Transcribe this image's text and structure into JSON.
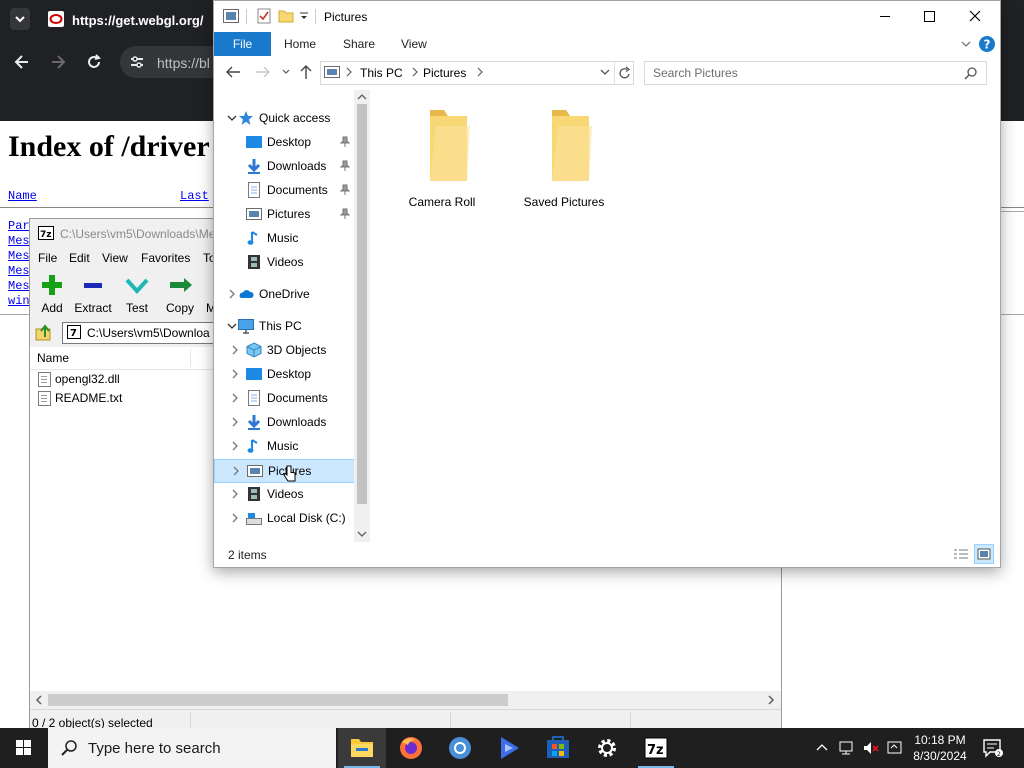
{
  "browser": {
    "tab_title": "https://get.webgl.org/",
    "url": "https://bl",
    "page_heading": "Index of /driver",
    "col_name": "Name",
    "col_last": "Last",
    "links": [
      "Par",
      "Mes",
      "Mes",
      "Mes",
      "Mes",
      "win"
    ]
  },
  "sevenzip": {
    "title": "C:\\Users\\vm5\\Downloads\\Me",
    "menu": [
      "File",
      "Edit",
      "View",
      "Favorites",
      "To"
    ],
    "toolbar": {
      "add": "Add",
      "extract": "Extract",
      "test": "Test",
      "copy": "Copy",
      "move": "M"
    },
    "address": "C:\\Users\\vm5\\Downloa",
    "column_name": "Name",
    "files": [
      "opengl32.dll",
      "README.txt"
    ],
    "status": "0 / 2 object(s) selected"
  },
  "explorer": {
    "title": "Pictures",
    "ribbon_tabs": {
      "file": "File",
      "home": "Home",
      "share": "Share",
      "view": "View"
    },
    "breadcrumb": {
      "root": "This PC",
      "current": "Pictures"
    },
    "search_placeholder": "Search Pictures",
    "nav": {
      "quick_access": "Quick access",
      "quick_items": [
        "Desktop",
        "Downloads",
        "Documents",
        "Pictures",
        "Music",
        "Videos"
      ],
      "onedrive": "OneDrive",
      "this_pc": "This PC",
      "pc_items": [
        "3D Objects",
        "Desktop",
        "Documents",
        "Downloads",
        "Music",
        "Pictures",
        "Videos",
        "Local Disk (C:)"
      ]
    },
    "folders": [
      "Camera Roll",
      "Saved Pictures"
    ],
    "status": "2 items"
  },
  "taskbar": {
    "search_placeholder": "Type here to search",
    "time": "10:18 PM",
    "date": "8/30/2024"
  },
  "colors": {
    "accent": "#1979ca",
    "folder": "#f8d775",
    "selection": "#cce8ff",
    "taskbar": "#1f1f1f"
  }
}
